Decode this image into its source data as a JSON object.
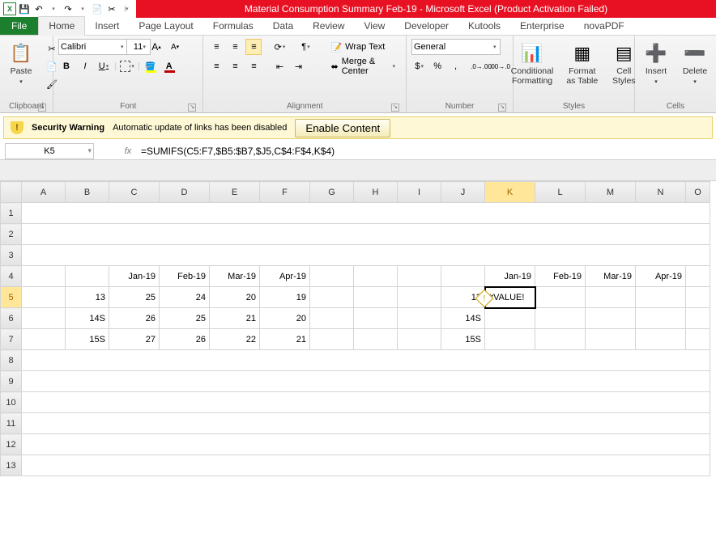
{
  "titlebar": {
    "title": "Material Consumption Summary Feb-19  -  Microsoft Excel (Product Activation Failed)"
  },
  "qat": {
    "excel": "X",
    "save": "💾",
    "undo": "↶",
    "redo": "↷"
  },
  "tabs": {
    "file": "File",
    "items": [
      "Home",
      "Insert",
      "Page Layout",
      "Formulas",
      "Data",
      "Review",
      "View",
      "Developer",
      "Kutools",
      "Enterprise",
      "novaPDF"
    ],
    "active": "Home"
  },
  "ribbon": {
    "clipboard": {
      "label": "Clipboard",
      "paste": "Paste"
    },
    "font": {
      "label": "Font",
      "name": "Calibri",
      "size": "11",
      "increase": "A",
      "decrease": "A",
      "bold": "B",
      "italic": "I",
      "underline": "U"
    },
    "alignment": {
      "label": "Alignment",
      "wrap": "Wrap Text",
      "merge": "Merge & Center"
    },
    "number": {
      "label": "Number",
      "format": "General",
      "currency": "$",
      "percent": "%",
      "comma": ","
    },
    "styles": {
      "label": "Styles",
      "cond": "Conditional\nFormatting",
      "table": "Format\nas Table",
      "cell": "Cell\nStyles"
    },
    "cells": {
      "label": "Cells",
      "insert": "Insert",
      "delete": "Delete"
    }
  },
  "security": {
    "title": "Security Warning",
    "msg": "Automatic update of links has been disabled",
    "button": "Enable Content"
  },
  "fx": {
    "cell": "K5",
    "label": "fx",
    "formula": "=SUMIFS(C5:F7,$B5:$B7,$J5,C$4:F$4,K$4)"
  },
  "sheet": {
    "columns": [
      "A",
      "B",
      "C",
      "D",
      "E",
      "F",
      "G",
      "H",
      "I",
      "J",
      "K",
      "L",
      "M",
      "N",
      "O"
    ],
    "row4": {
      "C": "Jan-19",
      "D": "Feb-19",
      "E": "Mar-19",
      "F": "Apr-19",
      "K": "Jan-19",
      "L": "Feb-19",
      "M": "Mar-19",
      "N": "Apr-19"
    },
    "row5": {
      "B": "13",
      "C": "25",
      "D": "24",
      "E": "20",
      "F": "19",
      "J": "13",
      "K": "#VALUE!"
    },
    "row6": {
      "B": "14S",
      "C": "26",
      "D": "25",
      "E": "21",
      "F": "20",
      "J": "14S"
    },
    "row7": {
      "B": "15S",
      "C": "27",
      "D": "26",
      "E": "22",
      "F": "21",
      "J": "15S"
    },
    "active": "K5",
    "error_marker": "!"
  }
}
